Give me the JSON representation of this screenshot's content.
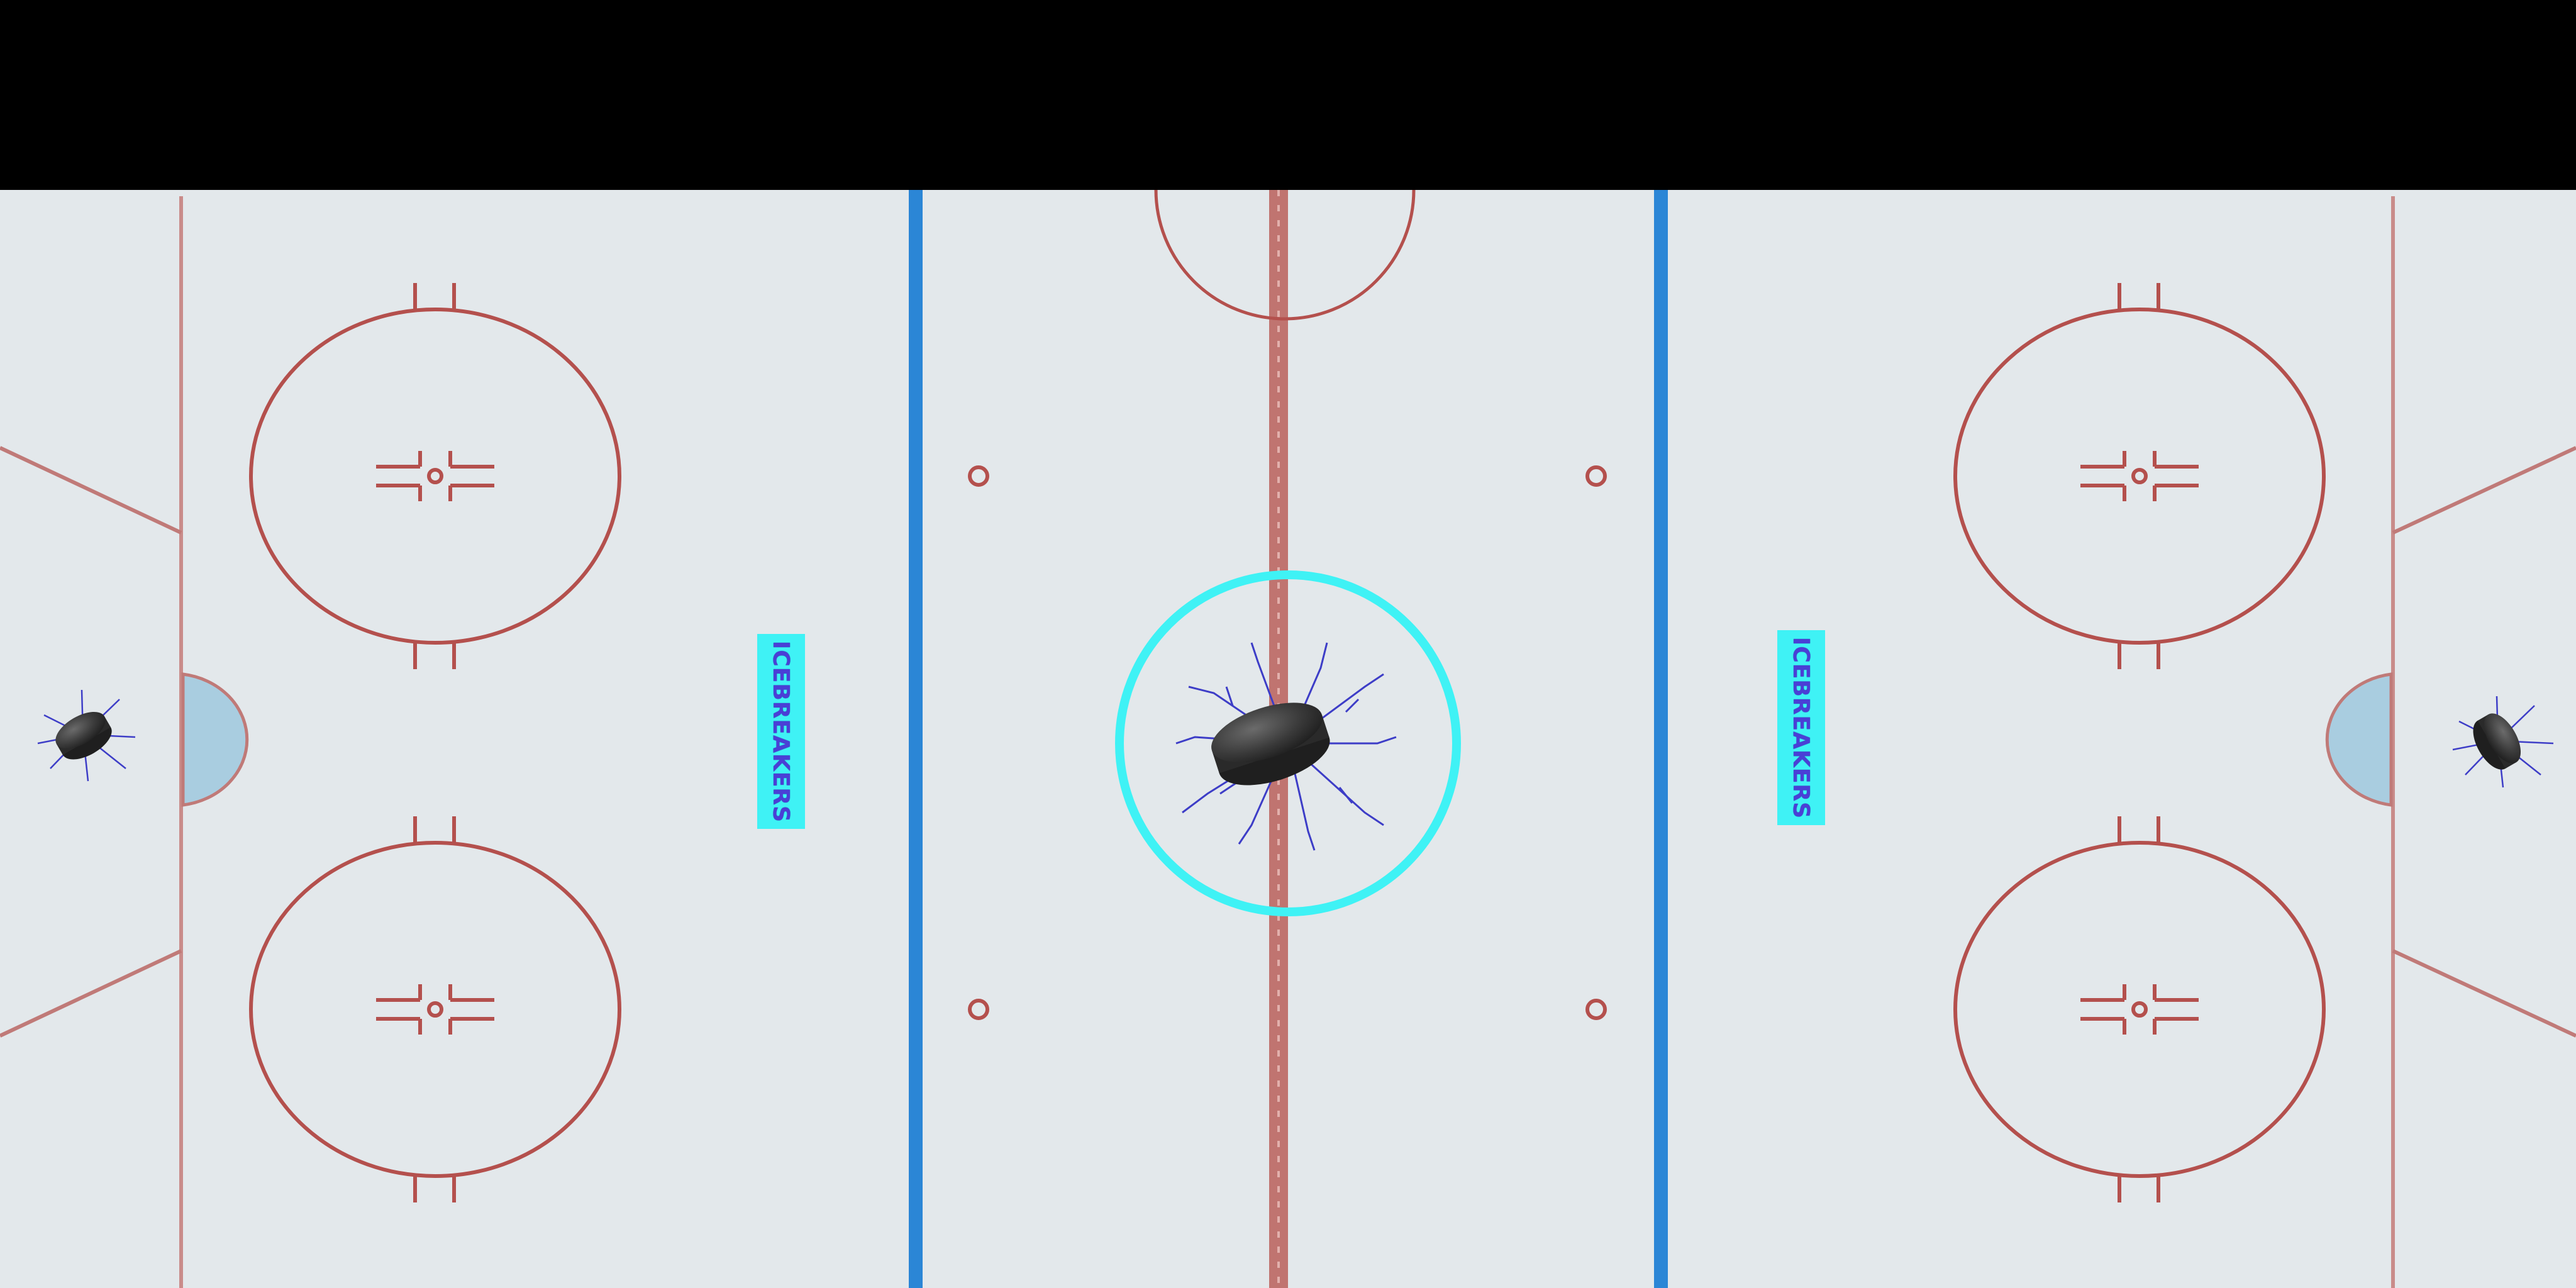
{
  "rink": {
    "team_name": "ICEBREAKERS"
  },
  "colors": {
    "ice": "#e3e8eb",
    "red_line": "#c07470",
    "circle_line": "#b4504d",
    "blue_line": "#2b86d6",
    "crease": "#a9cde0",
    "target_ring": "#3ff2f5",
    "sign_bg": "#3ff2f5",
    "sign_text": "#4a3fd6",
    "puck": "#3a3a3a",
    "crack": "#3d3dc7"
  },
  "icons": {
    "center_puck": "hockey-puck-icon",
    "left_puck": "hockey-puck-icon",
    "right_puck": "hockey-puck-icon"
  }
}
